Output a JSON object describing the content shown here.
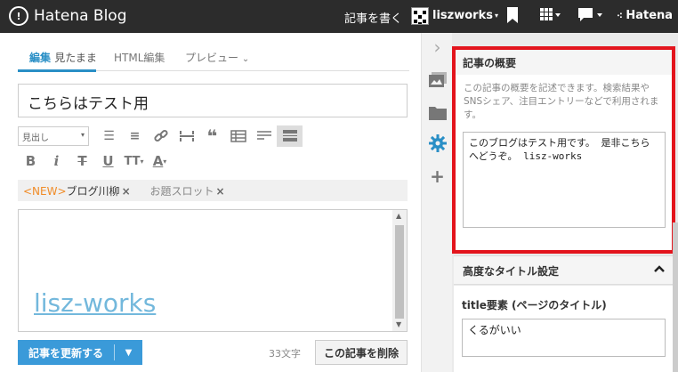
{
  "topbar": {
    "logo": "Hatena Blog",
    "write": "記事を書く",
    "user": "liszworks",
    "hatena": "Hatena",
    "icons": [
      "bookmark-icon",
      "apps-grid-icon",
      "speech-bubble-icon"
    ]
  },
  "editor": {
    "tabs": {
      "edit": "編集",
      "edit_sub": "見たまま",
      "html": "HTML編集",
      "preview": "プレビュー"
    },
    "title_value": "こちらはテスト用",
    "format_select": "見出し",
    "tools_row1": [
      "bulleted-list-icon",
      "numbered-list-icon",
      "link-icon",
      "horizontal-rule-icon",
      "quote-icon",
      "table-icon",
      "more-icon",
      "read-more-icon"
    ],
    "tools_row2": [
      "bold-icon",
      "italic-icon",
      "strikethrough-icon",
      "underline-icon",
      "text-size-icon",
      "text-color-icon"
    ],
    "tags": {
      "new": "<NEW>",
      "tag1": "ブログ川柳",
      "tag2": "お題スロット"
    },
    "body_text": "lisz-works",
    "update_button": "記事を更新する",
    "char_count": "33文字",
    "delete_button": "この記事を削除"
  },
  "sidebar": {
    "strip_icons": [
      "collapse-chevron-icon",
      "image-icon",
      "folder-icon",
      "settings-gear-icon",
      "add-plus-icon"
    ],
    "summary": {
      "title": "記事の概要",
      "description": "この記事の概要を記述できます。検索結果やSNSシェア、注目エントリーなどで利用されます。",
      "value": "このブログはテスト用です。 是非こちらへどうぞ。 lisz-works"
    },
    "advanced": {
      "title": "高度なタイトル設定"
    },
    "title_element": {
      "label": "title要素 (ページのタイトル)",
      "value": "くるがいい"
    }
  },
  "colors": {
    "topbar": "#2c2c2c",
    "accent": "#2a8fc6",
    "highlight_border": "#e3141c",
    "link": "#73b8dc",
    "new_tag": "#f08c28"
  }
}
